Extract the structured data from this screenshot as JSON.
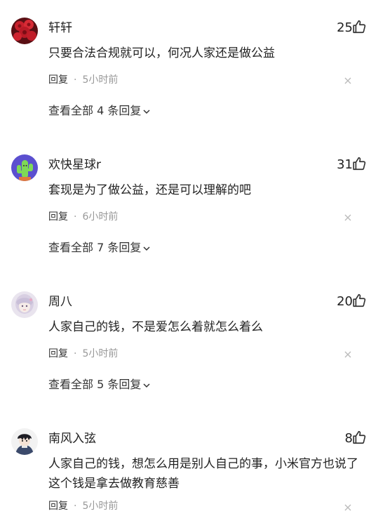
{
  "comments": [
    {
      "name": "轩轩",
      "likes": "25",
      "text": "只要合法合规就可以，何况人家还是做公益",
      "reply_label": "回复",
      "separator": "·",
      "time": "5小时前",
      "expand_label": "查看全部 4 条回复",
      "avatar_icon": "red-roses-avatar"
    },
    {
      "name": "欢快星球r",
      "likes": "31",
      "text": "套现是为了做公益，还是可以理解的吧",
      "reply_label": "回复",
      "separator": "·",
      "time": "6小时前",
      "expand_label": "查看全部 7 条回复",
      "avatar_icon": "cactus-avatar"
    },
    {
      "name": "周八",
      "likes": "20",
      "text": "人家自己的钱，不是爱怎么着就怎么着么",
      "reply_label": "回复",
      "separator": "·",
      "time": "5小时前",
      "expand_label": "查看全部 5 条回复",
      "avatar_icon": "anime-girl-avatar"
    },
    {
      "name": "南风入弦",
      "likes": "8",
      "text": "人家自己的钱，想怎么用是别人自己的事，小米官方也说了这个钱是拿去做教育慈善",
      "reply_label": "回复",
      "separator": "·",
      "time": "5小时前",
      "avatar_icon": "anime-boy-avatar"
    }
  ],
  "colors": {
    "text": "#222222",
    "meta": "#999999",
    "icon": "#333333",
    "background": "#ffffff"
  }
}
